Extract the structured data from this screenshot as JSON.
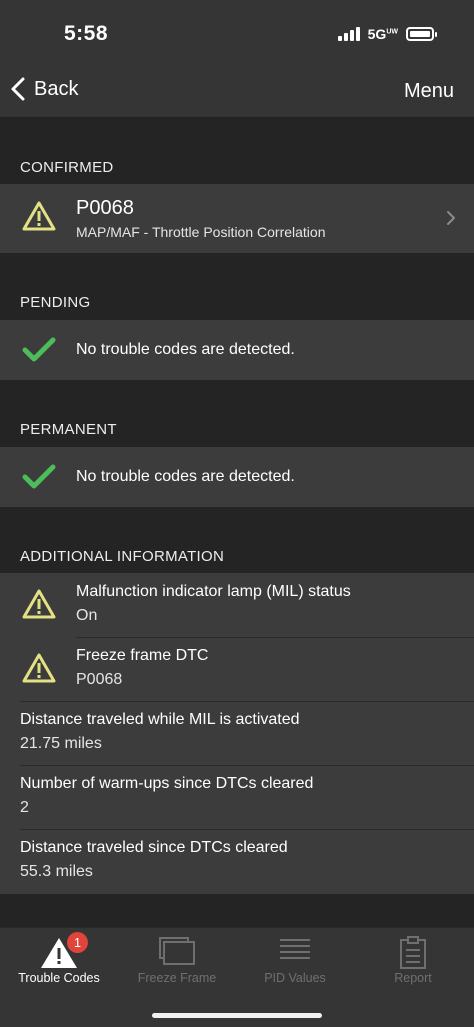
{
  "status_bar": {
    "time": "5:58",
    "network": "5G",
    "network_sup": "UW"
  },
  "nav": {
    "back_label": "Back",
    "menu_label": "Menu"
  },
  "sections": {
    "confirmed": "CONFIRMED",
    "pending": "PENDING",
    "permanent": "PERMANENT",
    "additional": "ADDITIONAL INFORMATION"
  },
  "confirmed_item": {
    "code": "P0068",
    "description": "MAP/MAF - Throttle Position Correlation"
  },
  "pending_item": {
    "message": "No trouble codes are detected."
  },
  "permanent_item": {
    "message": "No trouble codes are detected."
  },
  "additional_info": [
    {
      "label": "Malfunction indicator lamp (MIL) status",
      "value": "On"
    },
    {
      "label": "Freeze frame DTC",
      "value": "P0068"
    },
    {
      "label": "Distance traveled while MIL is activated",
      "value": "21.75 miles"
    },
    {
      "label": "Number of warm-ups since DTCs cleared",
      "value": "2"
    },
    {
      "label": "Distance traveled since DTCs cleared",
      "value": "55.3 miles"
    }
  ],
  "tabs": [
    {
      "label": "Trouble Codes",
      "badge": "1"
    },
    {
      "label": "Freeze Frame"
    },
    {
      "label": "PID Values"
    },
    {
      "label": "Report"
    }
  ],
  "colors": {
    "warning": "#e4e184",
    "ok": "#4dbd5c",
    "badge": "#e0443a",
    "inactive_tab": "#6f6f6f"
  }
}
